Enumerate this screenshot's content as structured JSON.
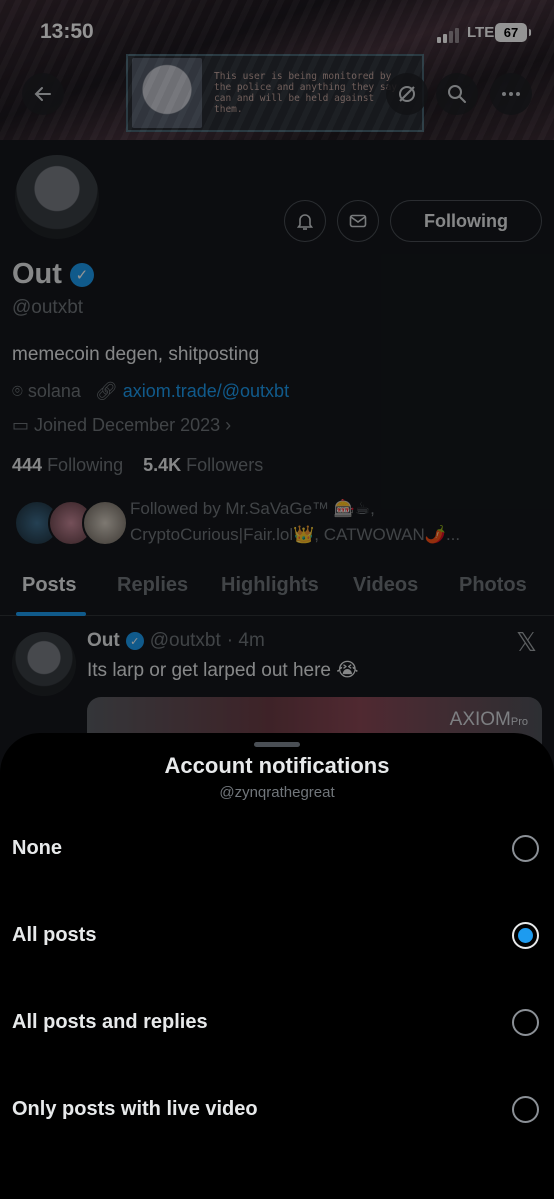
{
  "status_bar": {
    "time": "13:50",
    "network": "LTE",
    "battery": "67"
  },
  "banner": {
    "notice_text": "This user is being monitored by the police and anything they say can and will be held against them."
  },
  "profile": {
    "name": "Out",
    "handle": "@outxbt",
    "bio": "memecoin degen, shitposting",
    "location": "solana",
    "link": "axiom.trade/@outxbt",
    "joined": "Joined December 2023",
    "following_count": "444",
    "following_label": "Following",
    "followers_count": "5.4K",
    "followers_label": "Followers",
    "followed_by_line1": "Followed by Mr.SaVaGe™ 🎰☕,",
    "followed_by_line2": "CryptoCurious|Fair.lol👑, CATWOWAN🌶️...",
    "following_button": "Following"
  },
  "tabs": [
    "Posts",
    "Replies",
    "Highlights",
    "Videos",
    "Photos"
  ],
  "tweet": {
    "name": "Out",
    "handle": "@outxbt",
    "time": "· 4m",
    "text": "Its larp or get larped out here 😭",
    "media_label": "AXIOM",
    "media_label_suffix": "Pro"
  },
  "sheet": {
    "title": "Account notifications",
    "subtitle": "@zynqrathegreat",
    "options": [
      {
        "label": "None",
        "selected": false
      },
      {
        "label": "All posts",
        "selected": true
      },
      {
        "label": "All posts and replies",
        "selected": false
      },
      {
        "label": "Only posts with live video",
        "selected": false
      }
    ]
  },
  "colors": {
    "accent": "#1d9bf0",
    "sheet_bg": "#000000",
    "muted": "#71767b"
  }
}
